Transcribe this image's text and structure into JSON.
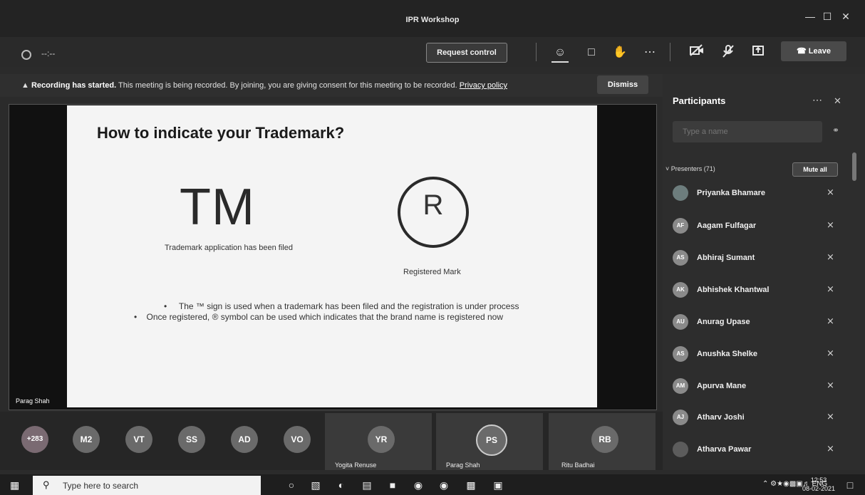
{
  "window": {
    "title": "IPR Workshop",
    "controls": [
      "—",
      "☐",
      "✕"
    ]
  },
  "toolbar": {
    "timer": "--:--",
    "request_control": "Request control",
    "icons": [
      "participants-icon",
      "chat-icon",
      "raise-hand-icon",
      "more-icon",
      "camera-off-icon",
      "mic-off-icon",
      "share-icon"
    ],
    "leave_label": "Leave"
  },
  "banner": {
    "bold": "Recording has started.",
    "text": "This meeting is being recorded. By joining, you are giving consent for this meeting to be recorded.",
    "link": "Privacy policy",
    "dismiss": "Dismiss"
  },
  "slide": {
    "title": "How to indicate your Trademark?",
    "tm_symbol": "TM",
    "tm_caption": "Trademark application has been filed",
    "r_symbol": "R",
    "r_caption": "Registered Mark",
    "bullets": [
      "The ™ sign is used when a trademark has been filed and the registration is under process",
      "Once registered, ® symbol can be used which indicates that the brand name is registered now"
    ],
    "presenter": "Parag Shah"
  },
  "strip": {
    "avatars": [
      "+283",
      "M2",
      "VT",
      "SS",
      "AD",
      "VO"
    ],
    "tiles": [
      {
        "initials": "YR",
        "name": "Yogita Renuse"
      },
      {
        "initials": "PS",
        "name": "Parag Shah"
      },
      {
        "initials": "RB",
        "name": "Ritu Badhai"
      }
    ]
  },
  "participants": {
    "title": "Participants",
    "search_placeholder": "Type a name",
    "section": "Presenters (71)",
    "mute_all": "Mute all",
    "people": [
      {
        "initials": "",
        "name": "Priyanka Bhamare"
      },
      {
        "initials": "AF",
        "name": "Aagam Fulfagar"
      },
      {
        "initials": "AS",
        "name": "Abhiraj Sumant"
      },
      {
        "initials": "AK",
        "name": "Abhishek Khantwal"
      },
      {
        "initials": "AU",
        "name": "Anurag Upase"
      },
      {
        "initials": "AS",
        "name": "Anushka Shelke"
      },
      {
        "initials": "AM",
        "name": "Apurva Mane"
      },
      {
        "initials": "AJ",
        "name": "Atharv Joshi"
      },
      {
        "initials": "",
        "name": "Atharva Pawar"
      }
    ]
  },
  "taskbar": {
    "search_placeholder": "Type here to search",
    "language": "ENG",
    "time": "12:53",
    "date": "08-02-2021"
  }
}
